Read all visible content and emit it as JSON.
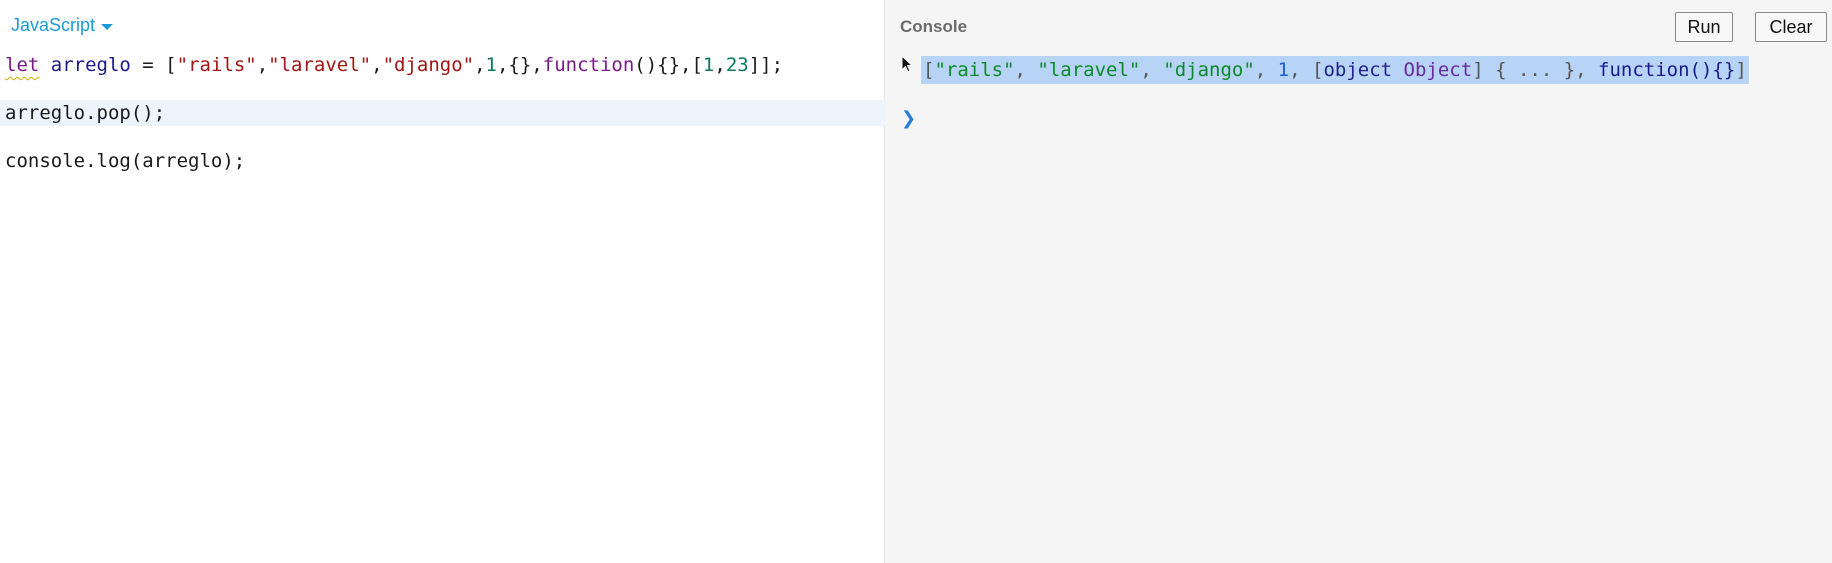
{
  "editor": {
    "language": "JavaScript",
    "lines": [
      {
        "tokens": [
          {
            "t": "let",
            "c": "kw-let"
          },
          {
            "t": " ",
            "c": "pun"
          },
          {
            "t": "arreglo",
            "c": "var"
          },
          {
            "t": " = [",
            "c": "pun"
          },
          {
            "t": "\"rails\"",
            "c": "str"
          },
          {
            "t": ",",
            "c": "pun"
          },
          {
            "t": "\"laravel\"",
            "c": "str"
          },
          {
            "t": ",",
            "c": "pun"
          },
          {
            "t": "\"django\"",
            "c": "str"
          },
          {
            "t": ",",
            "c": "pun"
          },
          {
            "t": "1",
            "c": "num"
          },
          {
            "t": ",{},",
            "c": "pun"
          },
          {
            "t": "function",
            "c": "kw"
          },
          {
            "t": "(){},[",
            "c": "pun"
          },
          {
            "t": "1",
            "c": "num"
          },
          {
            "t": ",",
            "c": "pun"
          },
          {
            "t": "23",
            "c": "num"
          },
          {
            "t": "]];",
            "c": "pun"
          }
        ]
      },
      {
        "tokens": [
          {
            "t": "arreglo.pop();",
            "c": "pun"
          }
        ]
      },
      {
        "tokens": [
          {
            "t": "console.log(arreglo);",
            "c": "pun"
          }
        ]
      }
    ]
  },
  "console": {
    "title": "Console",
    "run_label": "Run",
    "clear_label": "Clear",
    "prompt_symbol": "❯",
    "output": [
      {
        "t": "[",
        "c": "o-br"
      },
      {
        "t": "\"rails\"",
        "c": "o-str"
      },
      {
        "t": ", ",
        "c": "o-gray"
      },
      {
        "t": "\"laravel\"",
        "c": "o-str"
      },
      {
        "t": ", ",
        "c": "o-gray"
      },
      {
        "t": "\"django\"",
        "c": "o-str"
      },
      {
        "t": ", ",
        "c": "o-gray"
      },
      {
        "t": "1",
        "c": "o-num"
      },
      {
        "t": ", ",
        "c": "o-gray"
      },
      {
        "t": "[",
        "c": "o-br"
      },
      {
        "t": "object ",
        "c": "o-obj"
      },
      {
        "t": "Object",
        "c": "o-objn"
      },
      {
        "t": "] { ... }",
        "c": "o-br"
      },
      {
        "t": ", ",
        "c": "o-gray"
      },
      {
        "t": "function",
        "c": "o-fn"
      },
      {
        "t": "(){}",
        "c": "o-fn"
      },
      {
        "t": "]",
        "c": "o-br"
      }
    ]
  },
  "colors": {
    "accent": "#1a9bd7",
    "selection": "#b7d3f5",
    "active_line": "#eef4fc",
    "console_bg": "#f5f5f5"
  }
}
